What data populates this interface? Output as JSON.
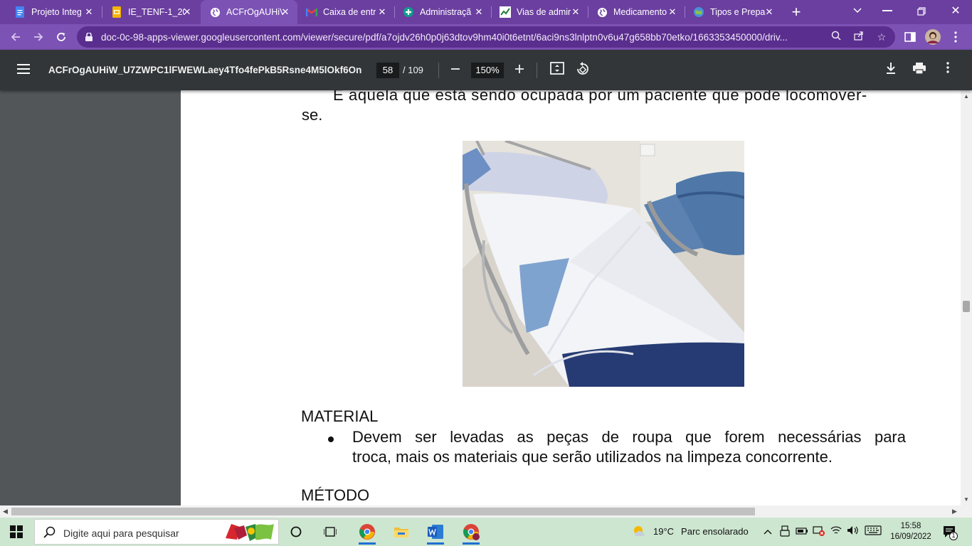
{
  "browser": {
    "tabs": [
      {
        "title": "Projeto Integ",
        "icon": "docs-icon",
        "active": false
      },
      {
        "title": "IE_TENF-1_20",
        "icon": "slides-icon",
        "active": false
      },
      {
        "title": "ACFrOgAUHiV",
        "icon": "globe-icon",
        "active": true
      },
      {
        "title": "Caixa de entr",
        "icon": "gmail-icon",
        "active": false
      },
      {
        "title": "Administraçã",
        "icon": "medical-icon",
        "active": false
      },
      {
        "title": "Vias de admir",
        "icon": "chart-icon",
        "active": false
      },
      {
        "title": "Medicamento",
        "icon": "globe-icon",
        "active": false
      },
      {
        "title": "Tipos e Prepa",
        "icon": "globe-color-icon",
        "active": false
      }
    ],
    "url": "doc-0c-98-apps-viewer.googleusercontent.com/viewer/secure/pdf/a7ojdv26h0p0j63dtov9hm40i0t6etnt/6aci9ns3lnlptn0v6u47g658bb70etko/1663353450000/driv..."
  },
  "pdf_viewer": {
    "doc_title": "ACFrOgAUHiW_U7ZWPC1lFWEWLaey4Tfo4fePkB5Rsne4M5lOkf6On...",
    "page_current": "58",
    "page_total": "/ 109",
    "zoom": "150%"
  },
  "page": {
    "para_line1": "É aquela que está sendo ocupada por um paciente que pode locomover-",
    "para_line2": "se.",
    "heading_material": "MATERIAL",
    "bullet_line1": "Devem ser levadas as peças de roupa que forem necessárias para",
    "bullet_line2": "troca, mais os materiais que serão utilizados na limpeza concorrente.",
    "heading_metodo": "MÉTODO"
  },
  "taskbar": {
    "search_placeholder": "Digite aqui para pesquisar",
    "weather_temp": "19°C",
    "weather_desc": "Parc ensolarado",
    "time": "15:58",
    "date": "16/09/2022",
    "notification_count": "1"
  }
}
